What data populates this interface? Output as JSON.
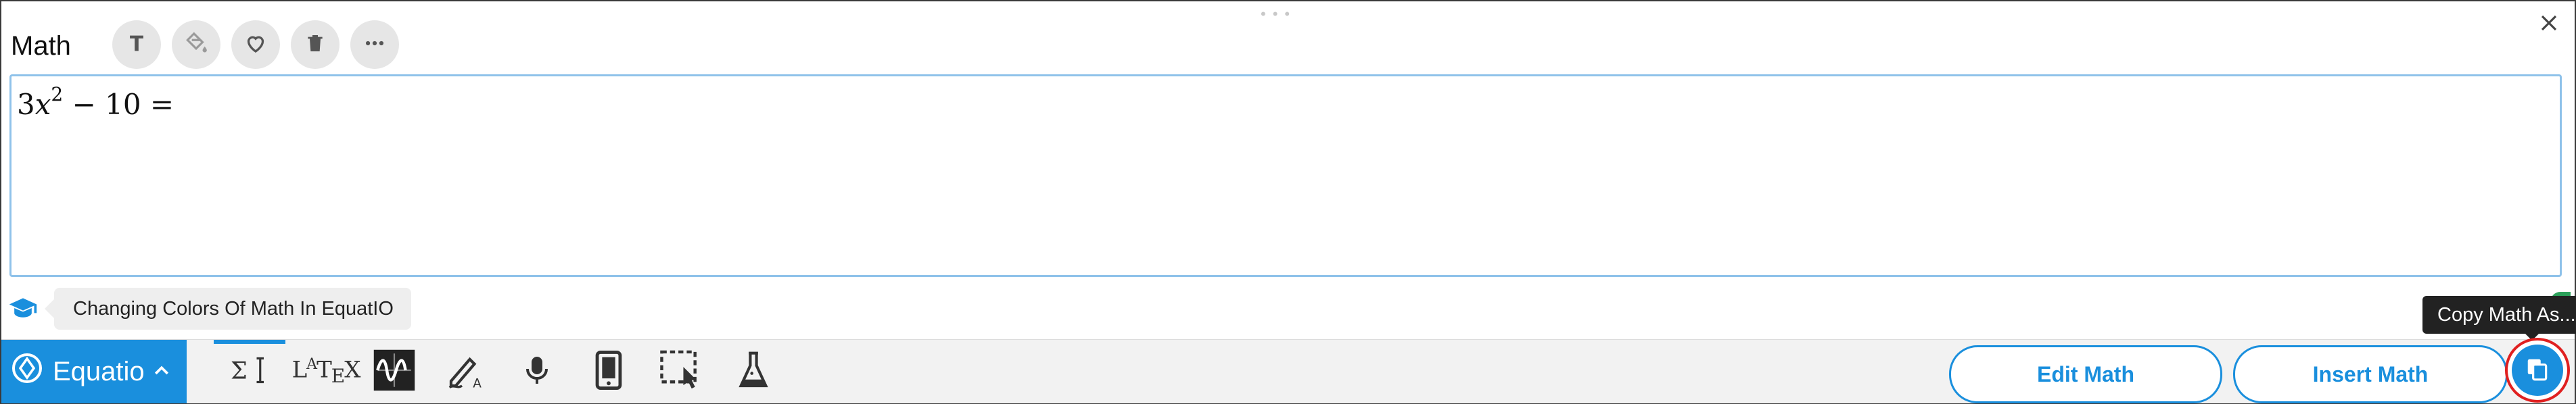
{
  "panel": {
    "title": "Math",
    "toolbar": [
      {
        "icon": "text-format-icon"
      },
      {
        "icon": "paint-bucket-icon"
      },
      {
        "icon": "heart-icon"
      },
      {
        "icon": "trash-icon"
      },
      {
        "icon": "more-horizontal-icon"
      }
    ],
    "close_icon": "close-icon"
  },
  "editor": {
    "coef": "3",
    "var": "x",
    "exp": "2",
    "rest": " − 10 ="
  },
  "tip": {
    "icon": "graduation-cap-icon",
    "text": "Changing Colors Of Math In EquatIO"
  },
  "bottom_bar": {
    "brand": "Equatio",
    "tabs": [
      {
        "icon": "math-input-icon",
        "label": "ΣI",
        "active": true
      },
      {
        "icon": "latex-icon",
        "label": "LATEX",
        "active": false
      },
      {
        "icon": "graph-icon",
        "label": "",
        "active": false
      },
      {
        "icon": "handwriting-icon",
        "label": "",
        "active": false
      },
      {
        "icon": "microphone-icon",
        "label": "",
        "active": false
      },
      {
        "icon": "mobile-icon",
        "label": "",
        "active": false
      },
      {
        "icon": "screenshot-reader-icon",
        "label": "",
        "active": false
      },
      {
        "icon": "chemistry-flask-icon",
        "label": "",
        "active": false
      }
    ],
    "edit_math": "Edit Math",
    "insert_math": "Insert Math",
    "copy_tooltip": "Copy Math As..."
  },
  "colors": {
    "accent": "#1a8fdd",
    "highlight_ring": "#e02020",
    "status_green": "#2ca05a"
  }
}
